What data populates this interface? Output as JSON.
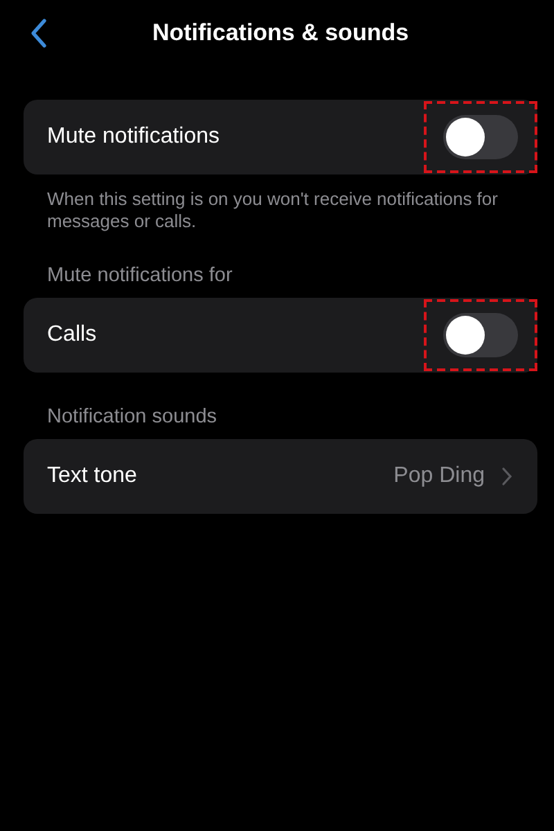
{
  "nav": {
    "title": "Notifications & sounds"
  },
  "sections": [
    {
      "rows": [
        {
          "kind": "toggle",
          "label": "Mute notifications",
          "on": false,
          "highlighted": true
        }
      ],
      "footer": "When this setting is on you won't receive notifications for messages or calls."
    },
    {
      "header": "Mute notifications for",
      "rows": [
        {
          "kind": "toggle",
          "label": "Calls",
          "on": false,
          "highlighted": true
        }
      ]
    },
    {
      "header": "Notification sounds",
      "rows": [
        {
          "kind": "link",
          "label": "Text tone",
          "value": "Pop Ding"
        }
      ]
    }
  ]
}
